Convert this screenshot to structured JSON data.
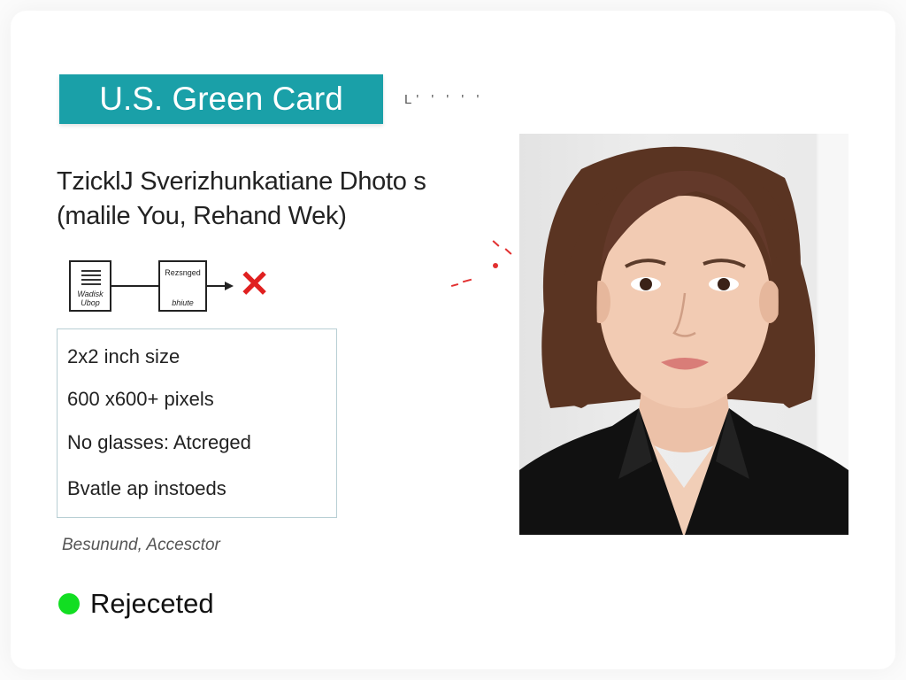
{
  "banner": {
    "title": "U.S. Green Card"
  },
  "banner_faint_text": "L' ' ' ' '",
  "headline": {
    "line1": "TzicklJ Sverizhunkatiane Dhoto s",
    "line2": "(malile You, Rehand Wek)"
  },
  "flow": {
    "box1_bottom": "Wadisk Ubop",
    "box2_top": "Rezsnged",
    "box2_bottom": "bhiute"
  },
  "requirements": [
    "2x2 inch size",
    "600 x600+ pixels",
    "No glasses: Atcreged",
    "Bvatle ap instoeds"
  ],
  "caption": "Besunund, Accesctor",
  "status": {
    "label": "Rejeceted",
    "color": "#12de22"
  },
  "colors": {
    "banner": "#1aa0a8",
    "reject_x": "#e02020",
    "annotation": "#e23030"
  },
  "icons": {
    "reject": "close-icon",
    "status": "status-dot-icon"
  },
  "photo": {
    "subject": "portrait photo of a woman with shoulder-length brown hair in a black blazer"
  }
}
